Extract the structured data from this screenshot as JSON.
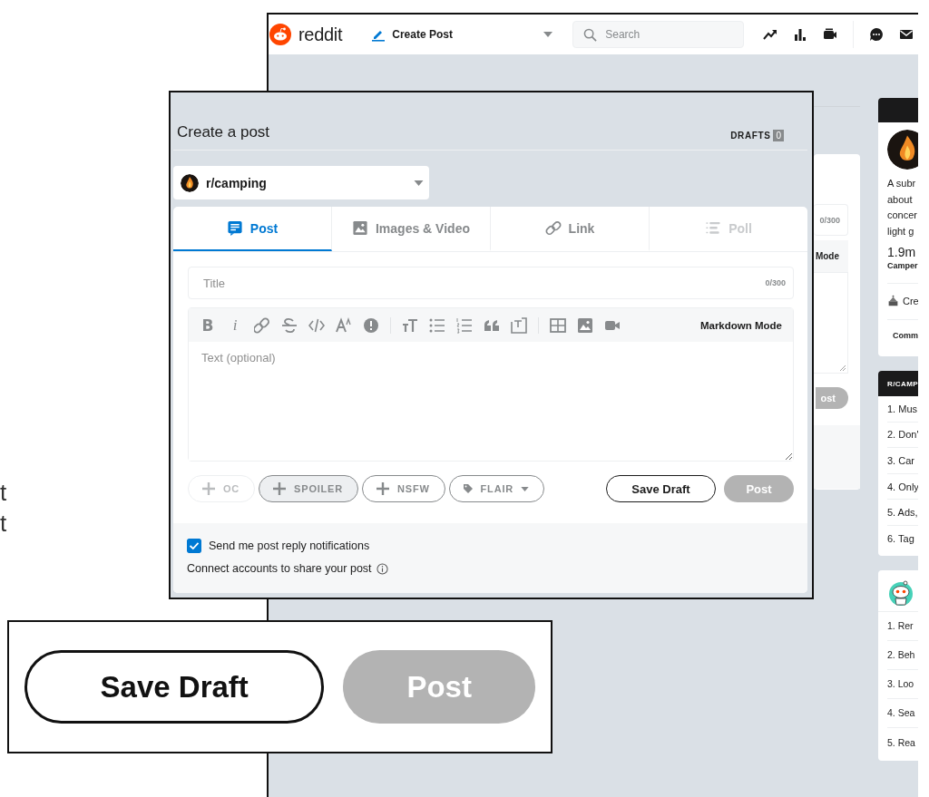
{
  "article_fragments": [
    "t",
    "t"
  ],
  "background_window": {
    "header": {
      "logo_text": "reddit",
      "page_selector": "Create Post",
      "search": {
        "placeholder": "Search"
      }
    },
    "behind": {
      "title_counter": "0/300",
      "editor_mode": "Mode",
      "post_button": "ost"
    },
    "sidebar": {
      "about": {
        "description_lines": [
          "A subr",
          "about",
          "concer",
          "light g"
        ],
        "members": "1.9m",
        "members_label": "Camper",
        "create_label": "Cre",
        "community_label": "Comm"
      },
      "rules": {
        "title": "R/CAMP",
        "items": [
          "1. Mus",
          "2. Don'",
          "3. Car",
          "4. Only",
          "5. Ads,",
          "6. Tag"
        ]
      },
      "reddit_rules": {
        "items": [
          "1. Rer",
          "2. Beh",
          "3. Loo",
          "4. Sea",
          "5. Rea"
        ]
      }
    }
  },
  "composer": {
    "title": "Create a post",
    "drafts_label": "DRAFTS",
    "drafts_count": "0",
    "community": "r/camping",
    "tabs": [
      {
        "label": "Post",
        "selected": true,
        "disabled": false
      },
      {
        "label": "Images & Video",
        "selected": false,
        "disabled": false
      },
      {
        "label": "Link",
        "selected": false,
        "disabled": false
      },
      {
        "label": "Poll",
        "selected": false,
        "disabled": true
      }
    ],
    "title_field": {
      "placeholder": "Title",
      "counter": "0/300"
    },
    "toolbar": {
      "format_buttons": [
        "B",
        "i"
      ],
      "mode_label": "Markdown Mode"
    },
    "body": {
      "placeholder": "Text (optional)"
    },
    "tags": [
      {
        "label": "OC",
        "kind": "plus",
        "disabled": true,
        "highlighted": false
      },
      {
        "label": "SPOILER",
        "kind": "plus",
        "disabled": false,
        "highlighted": true
      },
      {
        "label": "NSFW",
        "kind": "plus",
        "disabled": false,
        "highlighted": false
      },
      {
        "label": "FLAIR",
        "kind": "flair",
        "disabled": false,
        "highlighted": false
      }
    ],
    "save_button": "Save Draft",
    "post_button": {
      "label": "Post",
      "disabled": true
    },
    "notifications": {
      "label": "Send me post reply notifications",
      "checked": true
    },
    "connect_label": "Connect accounts to share your post"
  },
  "zoom_inset": {
    "save_button": "Save Draft",
    "post_button": {
      "label": "Post",
      "disabled": true
    }
  }
}
